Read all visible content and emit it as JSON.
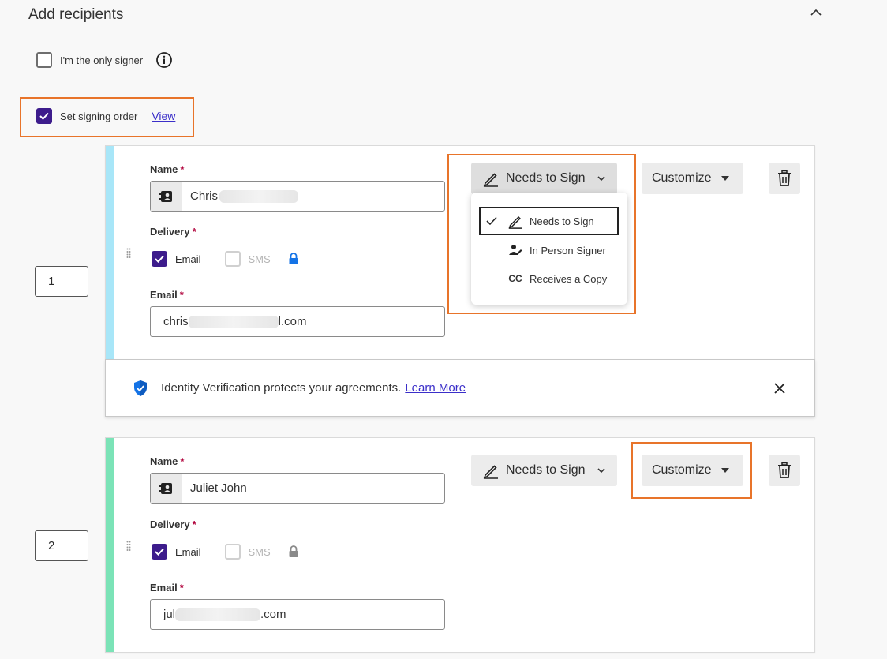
{
  "section": {
    "title": "Add recipients"
  },
  "only_signer": {
    "label": "I'm the only signer",
    "checked": false
  },
  "signing_order": {
    "label": "Set signing order",
    "checked": true,
    "view_link": "View"
  },
  "recipients": [
    {
      "order": "1",
      "accent": "#a8e6f8",
      "name_label": "Name",
      "name_value": "Chris",
      "delivery_label": "Delivery",
      "email_option": "Email",
      "sms_option": "SMS",
      "email_label": "Email",
      "email_value_start": "chris",
      "email_value_end": "l.com",
      "role": "Needs to Sign",
      "customize": "Customize",
      "lock_color": "#1473e6"
    },
    {
      "order": "2",
      "accent": "#7be3b7",
      "name_label": "Name",
      "name_value": "Juliet John",
      "delivery_label": "Delivery",
      "email_option": "Email",
      "sms_option": "SMS",
      "email_label": "Email",
      "email_value_start": "jul",
      "email_value_end": ".com",
      "role": "Needs to Sign",
      "customize": "Customize",
      "lock_color": "#8a8a8a"
    }
  ],
  "role_menu": {
    "items": [
      {
        "label": "Needs to Sign",
        "icon": "pen-icon",
        "selected": true
      },
      {
        "label": "In Person Signer",
        "icon": "in-person-signer-icon",
        "selected": false
      },
      {
        "label": "Receives a Copy",
        "icon": "cc-icon",
        "icon_text": "CC",
        "selected": false
      }
    ]
  },
  "identity_banner": {
    "text": "Identity Verification protects your agreements.",
    "link": "Learn More"
  },
  "colors": {
    "accent_purple": "#3d1c8c",
    "highlight": "#e8742a",
    "link": "#3b2fc9"
  }
}
